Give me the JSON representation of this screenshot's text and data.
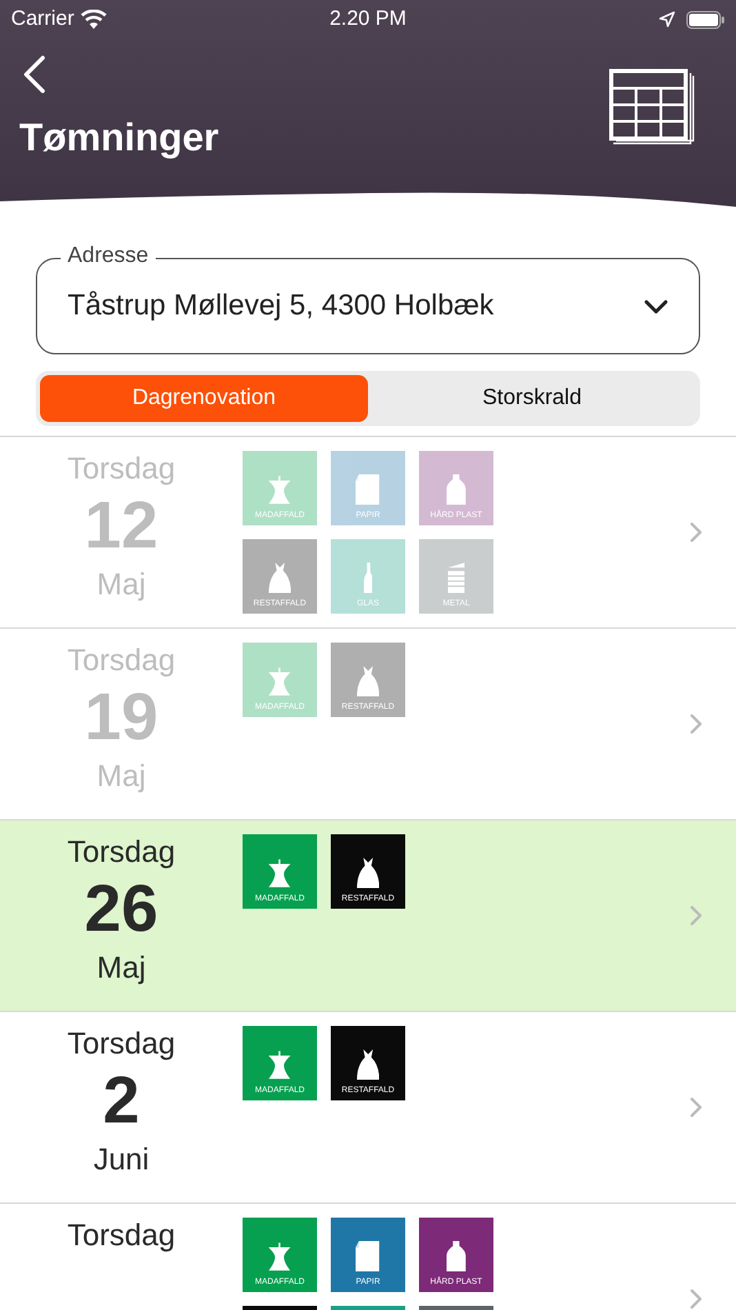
{
  "status_bar": {
    "carrier": "Carrier",
    "time": "2.20 PM"
  },
  "header": {
    "title": "Tømninger"
  },
  "address": {
    "label": "Adresse",
    "value": "Tåstrup Møllevej 5, 4300 Holbæk"
  },
  "segments": [
    {
      "label": "Dagrenovation",
      "selected": true
    },
    {
      "label": "Storskrald",
      "selected": false
    }
  ],
  "pickups": [
    {
      "weekday": "Torsdag",
      "day": "12",
      "month": "Maj",
      "past": true,
      "selected": false,
      "bins": [
        {
          "kind": "food",
          "label": "MADAFFALD"
        },
        {
          "kind": "paper",
          "label": "PAPIR"
        },
        {
          "kind": "plastic",
          "label": "HÅRD PLAST"
        },
        {
          "kind": "residual",
          "label": "RESTAFFALD"
        },
        {
          "kind": "glass",
          "label": "GLAS"
        },
        {
          "kind": "metal",
          "label": "METAL"
        }
      ]
    },
    {
      "weekday": "Torsdag",
      "day": "19",
      "month": "Maj",
      "past": true,
      "selected": false,
      "bins": [
        {
          "kind": "food",
          "label": "MADAFFALD"
        },
        {
          "kind": "residual",
          "label": "RESTAFFALD"
        }
      ]
    },
    {
      "weekday": "Torsdag",
      "day": "26",
      "month": "Maj",
      "past": false,
      "selected": true,
      "bins": [
        {
          "kind": "food",
          "label": "MADAFFALD"
        },
        {
          "kind": "residual",
          "label": "RESTAFFALD"
        }
      ]
    },
    {
      "weekday": "Torsdag",
      "day": "2",
      "month": "Juni",
      "past": false,
      "selected": false,
      "bins": [
        {
          "kind": "food",
          "label": "MADAFFALD"
        },
        {
          "kind": "residual",
          "label": "RESTAFFALD"
        }
      ]
    },
    {
      "weekday": "Torsdag",
      "past": false,
      "selected": false,
      "bins": [
        {
          "kind": "food",
          "label": "MADAFFALD"
        },
        {
          "kind": "paper",
          "label": "PAPIR"
        },
        {
          "kind": "plastic",
          "label": "HÅRD PLAST"
        },
        {
          "kind": "residual"
        },
        {
          "kind": "glass"
        },
        {
          "kind": "metal"
        }
      ]
    }
  ]
}
